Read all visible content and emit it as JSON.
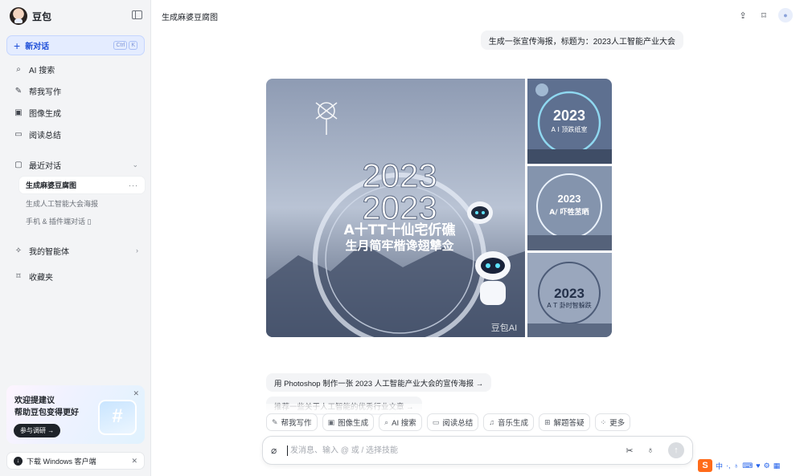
{
  "sidebar": {
    "brand": "豆包",
    "new_chat": {
      "label": "新对话",
      "kbd": [
        "Ctrl",
        "K"
      ]
    },
    "nav": [
      {
        "label": "AI 搜索",
        "icon": "search-icon"
      },
      {
        "label": "帮我写作",
        "icon": "pen-icon"
      },
      {
        "label": "图像生成",
        "icon": "image-icon"
      },
      {
        "label": "阅读总结",
        "icon": "book-icon"
      }
    ],
    "recent": {
      "label": "最近对话",
      "items": [
        {
          "label": "生成麻婆豆腐图",
          "active": true,
          "more": "···"
        },
        {
          "label": "生成人工智能大会海报"
        },
        {
          "label": "手机 & 插件端对话 ▯"
        }
      ]
    },
    "agents": "我的智能体",
    "favorites": "收藏夹",
    "promo": {
      "line1": "欢迎提建议",
      "line2": "帮助豆包变得更好",
      "button": "参与调研 →"
    },
    "download": "下载 Windows 客户端"
  },
  "header": {
    "title": "生成麻婆豆腐图"
  },
  "chat": {
    "user_message": "生成一张宣传海报，标题为：2023人工智能产业大会",
    "images": {
      "main": {
        "big_text": [
          "2023",
          "2023"
        ],
        "line1": "A十TT十仙宅伒礁",
        "line2": "生月简牢楷谗翅犨佥",
        "footer": "豆包AI"
      },
      "thumbs": [
        {
          "year": "2023",
          "sub": "A I 顶跌纸室"
        },
        {
          "year": "2023",
          "sub": "A/ 吓牲苤晒"
        },
        {
          "year": "2023",
          "sub": "A T 卦时智躲跌"
        }
      ]
    },
    "suggestions": [
      "用 Photoshop 制作一张 2023 人工智能产业大会的宣传海报 →",
      "推荐一些关于人工智能的优秀行业文章 →"
    ]
  },
  "toolbar": [
    {
      "label": "帮我写作",
      "icon": "pen-icon"
    },
    {
      "label": "图像生成",
      "icon": "image-icon"
    },
    {
      "label": "AI 搜索",
      "icon": "search-icon"
    },
    {
      "label": "阅读总结",
      "icon": "book-icon"
    },
    {
      "label": "音乐生成",
      "icon": "music-icon"
    },
    {
      "label": "解题答疑",
      "icon": "calculator-icon"
    },
    {
      "label": "更多",
      "icon": "grid-icon"
    }
  ],
  "composer": {
    "placeholder": "发消息、输入 @ 或 / 选择技能"
  },
  "ime": {
    "logo": "S",
    "lang": "中"
  }
}
